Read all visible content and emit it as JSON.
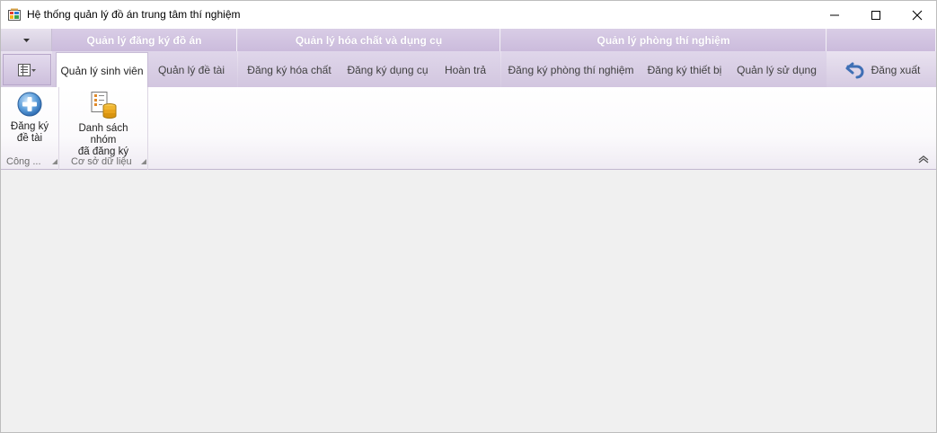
{
  "window": {
    "title": "Hệ thống quản lý đồ án trung tâm thí nghiệm",
    "icon": "app-icon",
    "controls": [
      "minimize-icon",
      "maximize-icon",
      "close-icon"
    ]
  },
  "ribbon": {
    "categories": [
      {
        "label": "Quản lý đăng ký đồ án"
      },
      {
        "label": "Quản lý hóa chất và dụng cụ"
      },
      {
        "label": "Quản lý phòng thí nghiệm"
      }
    ],
    "tabs": [
      {
        "label": "Quản lý sinh viên",
        "active": true
      },
      {
        "label": "Quản lý đề tài"
      },
      {
        "label": "Đăng ký hóa chất"
      },
      {
        "label": "Đăng ký dụng cụ"
      },
      {
        "label": "Hoàn trả"
      },
      {
        "label": "Đăng ký phòng thí nghiệm"
      },
      {
        "label": "Đăng ký thiết bị"
      },
      {
        "label": "Quản lý sử dụng"
      }
    ],
    "logout": {
      "label": "Đăng xuất",
      "icon": "undo-arrow-icon"
    },
    "groups": [
      {
        "label": "Công ...",
        "buttons": [
          {
            "label_line1": "Đăng ký",
            "label_line2": "đề tài",
            "icon": "add-circle-icon"
          }
        ]
      },
      {
        "label": "Cơ sở dữ liệu",
        "buttons": [
          {
            "label_line1": "Danh sách nhóm",
            "label_line2": "đã đăng ký",
            "icon": "database-list-icon"
          }
        ]
      }
    ]
  },
  "colors": {
    "ribbon_accent": "#d3c6e0",
    "category_text": "#ffffff",
    "logout_arrow": "#3f6fb5"
  }
}
